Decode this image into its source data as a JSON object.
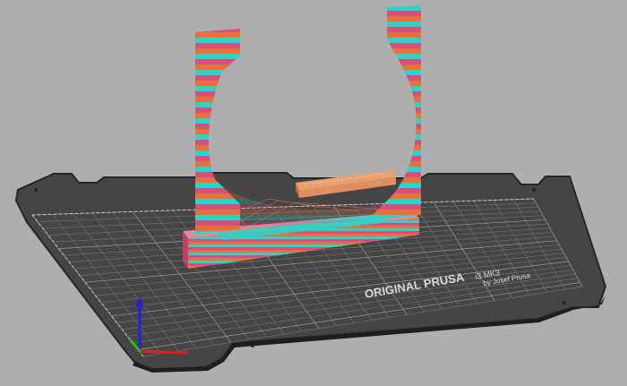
{
  "app": {
    "view": "3D preview"
  },
  "bed": {
    "logo_line1": "ORIGINAL PRUSA",
    "logo_model": "i3 MK3",
    "logo_line2": "by Josef Prusa",
    "surface_color": "#4a4a4a",
    "edge_color": "#2c2c2c",
    "grid_color": "#7a7a7a"
  },
  "model": {
    "layer_colors": [
      "#e8703a",
      "#2ed3c6",
      "#d6507e"
    ],
    "infill_color": "#e8a070",
    "top_color": "#d890a0"
  },
  "axes": {
    "x_color": "#e02020",
    "y_color": "#20c020",
    "z_color": "#2020e0"
  },
  "viewport": {
    "background": "#aeaeae"
  }
}
